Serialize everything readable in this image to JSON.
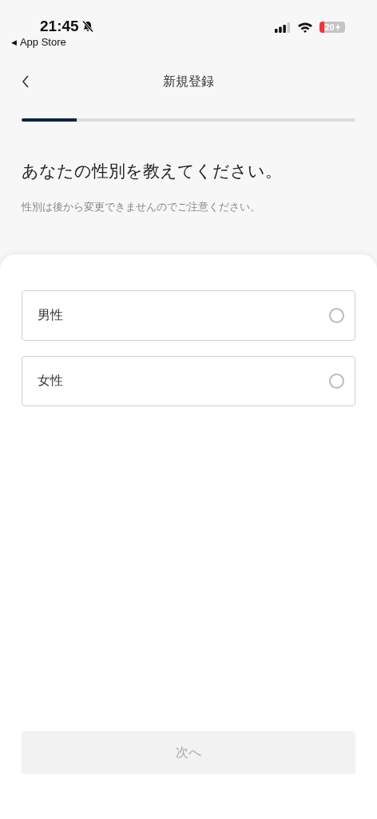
{
  "status_bar": {
    "time": "21:45",
    "back_arrow": "◀",
    "back_app": "App Store",
    "battery": "20"
  },
  "nav": {
    "title": "新規登録"
  },
  "progress": {
    "level": 0.165
  },
  "heading": "あなたの性別を教えてください。",
  "note": "性別は後から変更できませんのでご注意ください。",
  "options": [
    {
      "label": "男性",
      "selected": false
    },
    {
      "label": "女性",
      "selected": false
    }
  ],
  "next_button": {
    "label": "次へ",
    "disabled": true
  }
}
